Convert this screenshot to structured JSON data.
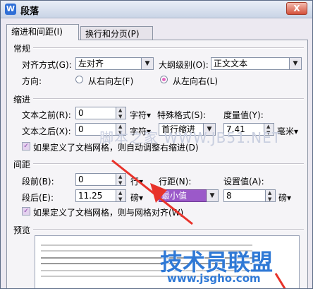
{
  "window": {
    "title": "段落",
    "close": "X"
  },
  "tabs": [
    {
      "label": "缩进和间距(I)",
      "active": true
    },
    {
      "label": "换行和分页(P)",
      "active": false
    }
  ],
  "general": {
    "section": "常规",
    "align_label": "对齐方式(G):",
    "align_value": "左对齐",
    "outline_label": "大纲级别(O):",
    "outline_value": "正文文本",
    "direction_label": "方向:",
    "rtl_label": "从右向左(F)",
    "ltr_label": "从左向右(L)",
    "selected_direction": "ltr"
  },
  "indent": {
    "section": "缩进",
    "before_label": "文本之前(R):",
    "before_value": "0",
    "before_unit": "字符▾",
    "after_label": "文本之后(X):",
    "after_value": "0",
    "after_unit": "字符▾",
    "special_label": "特殊格式(S):",
    "special_value": "首行缩进",
    "measure_label": "度量值(Y):",
    "measure_value": "7.41",
    "measure_unit": "毫米▾",
    "grid_check_label": "如果定义了文档网格，则自动调整右缩进(D)"
  },
  "spacing": {
    "section": "间距",
    "before_label": "段前(B):",
    "before_value": "0",
    "before_unit": "行▾",
    "after_label": "段后(E):",
    "after_value": "11.25",
    "after_unit": "磅▾",
    "line_label": "行距(N):",
    "line_value": "最小值",
    "set_label": "设置值(A):",
    "set_value": "8",
    "set_unit": "磅▾",
    "grid_check_label": "如果定义了文档网格，则与网格对齐(W)"
  },
  "preview": {
    "section": "预览"
  },
  "watermarks": {
    "top": "脚本之家 WWW.JB51.NET",
    "logo": "技术员联盟",
    "url": "www.jsgho.com"
  },
  "colors": {
    "accent": "#9b59c9",
    "arrow": "#e8322a"
  }
}
